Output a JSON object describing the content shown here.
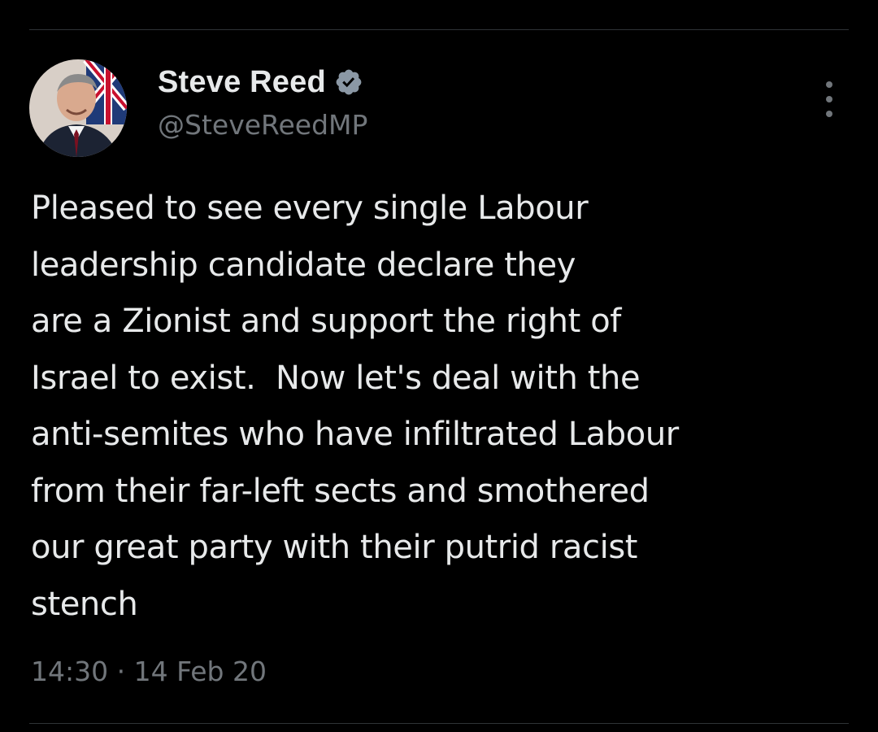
{
  "tweet": {
    "author": {
      "display_name": "Steve Reed",
      "handle": "@SteveReedMP",
      "verified_icon": "verified-badge-icon",
      "avatar": "profile-photo"
    },
    "menu_icon": "more-options-icon",
    "text_lines": [
      "Pleased to see every single Labour",
      "leadership candidate declare they",
      "are a Zionist and support the right of",
      "Israel to exist.  Now let's deal with the",
      "anti-semites who have infiltrated Labour",
      "from their far-left sects and smothered",
      "our great party with their putrid racist",
      "stench"
    ],
    "time": "14:30",
    "separator": " · ",
    "date": "14 Feb 20"
  },
  "colors": {
    "background": "#000000",
    "text_primary": "#e7e9ea",
    "text_secondary": "#71767b",
    "divider": "#2f3336",
    "verified_badge": "#8b98a5"
  }
}
